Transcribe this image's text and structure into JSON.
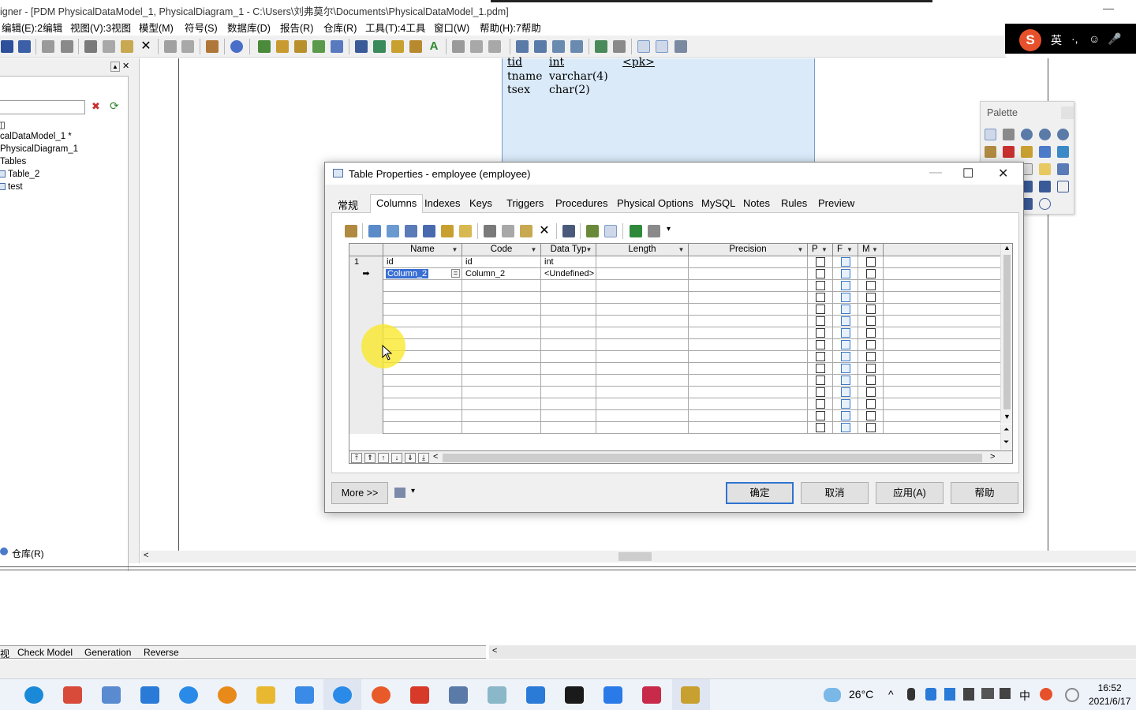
{
  "window": {
    "title": "igner - [PDM PhysicalDataModel_1, PhysicalDiagram_1 - C:\\Users\\刘弗莫尔\\Documents\\PhysicalDataModel_1.pdm]",
    "minimize_glyph": "—"
  },
  "menu": [
    "编辑(E):2编辑",
    "视图(V):3视图",
    "模型(M)",
    "符号(S)",
    "数据库(D)",
    "报告(R)",
    "仓库(R)",
    "工具(T):4工具",
    "窗口(W)",
    "帮助(H):7帮助"
  ],
  "ime": {
    "logo": "S",
    "lang": "英",
    "punct": "·,",
    "emoji": "☺",
    "mic": "🎤"
  },
  "browser": {
    "scroll_glyph": "▲",
    "close_glyph": "✕",
    "tree": [
      "calDataModel_1 *",
      "PhysicalDiagram_1",
      "Tables",
      "Table_2",
      "test"
    ],
    "root_glyph": "◫",
    "repository_tab": "仓库(R)"
  },
  "canvas": {
    "entity": {
      "columns": [
        {
          "name": "tid",
          "type": "int",
          "key": "<pk>"
        },
        {
          "name": "tname",
          "type": "varchar(4)",
          "key": ""
        },
        {
          "name": "tsex",
          "type": "char(2)",
          "key": ""
        }
      ]
    },
    "scroll_left_glyph": "<"
  },
  "palette": {
    "title": "Palette"
  },
  "dialog": {
    "title": "Table Properties - employee (employee)",
    "controls": {
      "min": "—",
      "max": "☐",
      "close": "✕"
    },
    "tabs": [
      "常规",
      "Columns",
      "Indexes",
      "Keys",
      "Triggers",
      "Procedures",
      "Physical Options",
      "MySQL",
      "Notes",
      "Rules",
      "Preview"
    ],
    "active_tab": "Columns",
    "grid": {
      "headers": [
        "Name",
        "Code",
        "Data Typ",
        "Length",
        "Precision",
        "P",
        "F",
        "M"
      ],
      "rows": [
        {
          "num": "1",
          "name": "id",
          "code": "id",
          "type": "int",
          "length": "",
          "precision": ""
        },
        {
          "num": "➡",
          "name": "Column_2",
          "code": "Column_2",
          "type": "<Undefined>",
          "length": "",
          "precision": ""
        }
      ],
      "eq_glyph": "=",
      "scroll_up": "▲",
      "scroll_down": "▼",
      "top_glyph": "⏶",
      "bottom_glyph": "⏷",
      "nav": [
        "⤒",
        "⇑",
        "↑",
        "↓",
        "⇓",
        "⤓"
      ],
      "h_left": "<",
      "h_right": ">"
    },
    "buttons": {
      "more": "More >>",
      "ok": "确定",
      "cancel": "取消",
      "apply": "应用(A)",
      "help": "帮助"
    },
    "dropdown_glyph": "▾"
  },
  "output_tabs": [
    "视",
    "Check Model",
    "Generation",
    "Reverse"
  ],
  "output_scroll_left": "<",
  "taskbar": {
    "weather": "26°C",
    "caret": "^",
    "ime_text": "中",
    "time": "16:52",
    "date": "2021/6/17"
  }
}
